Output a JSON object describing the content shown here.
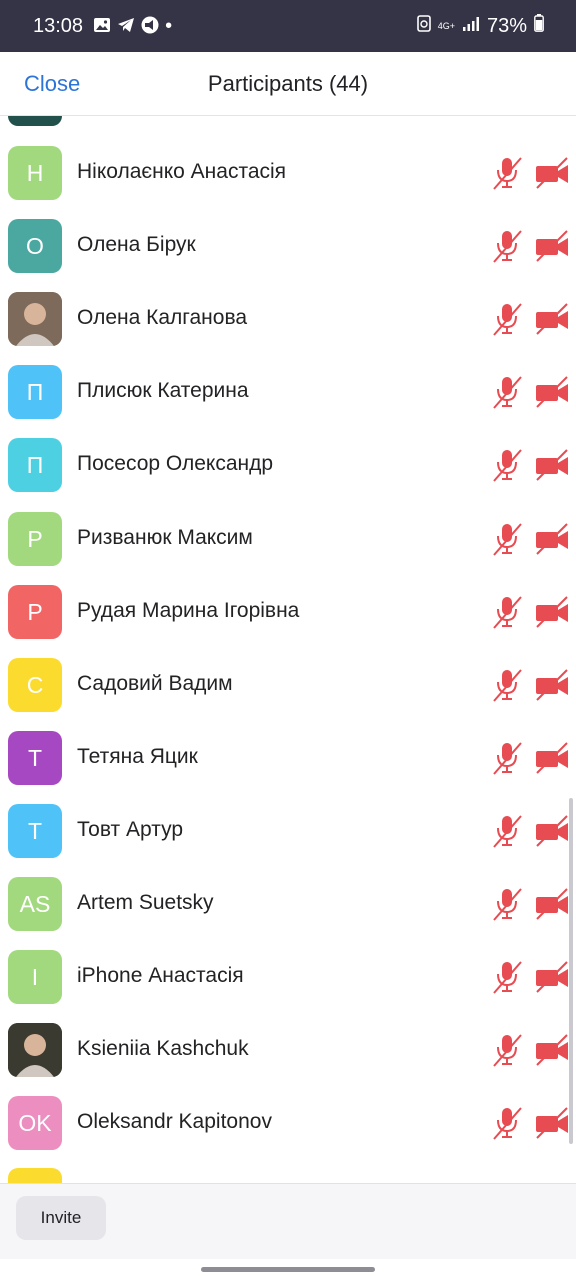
{
  "status_bar": {
    "time": "13:08",
    "icons": [
      "gallery-icon",
      "telegram-icon",
      "megaphone-icon"
    ],
    "dot": "•",
    "network": "4G+",
    "battery": "73%"
  },
  "header": {
    "close_label": "Close",
    "title": "Participants (44)"
  },
  "colors": {
    "accent": "#2d74d9",
    "muted_red": "#e74c52",
    "status_bar_bg": "#353346"
  },
  "participants": [
    {
      "initial": "Н",
      "name": "Ніколаєнко Анастасія",
      "color": "#a2d97e",
      "photo": false
    },
    {
      "initial": "О",
      "name": "Олена Бірук",
      "color": "#4aa8a1",
      "photo": false
    },
    {
      "initial": "",
      "name": "Олена Калганова",
      "color": "#7d6a5a",
      "photo": true
    },
    {
      "initial": "П",
      "name": "Плисюк Катерина",
      "color": "#4fc3f7",
      "photo": false
    },
    {
      "initial": "П",
      "name": "Посесор Олександр",
      "color": "#4dd0e1",
      "photo": false
    },
    {
      "initial": "Р",
      "name": "Ризванюк Максим",
      "color": "#a2d97e",
      "photo": false
    },
    {
      "initial": "Р",
      "name": "Рудая Марина Ігорівна",
      "color": "#f26565",
      "photo": false
    },
    {
      "initial": "С",
      "name": "Садовий Вадим",
      "color": "#fbdc2e",
      "photo": false
    },
    {
      "initial": "Т",
      "name": "Тетяна Яцик",
      "color": "#a648c2",
      "photo": false
    },
    {
      "initial": "Т",
      "name": "Товт Артур",
      "color": "#4fc3f7",
      "photo": false
    },
    {
      "initial": "AS",
      "name": "Artem Suetsky",
      "color": "#a2d97e",
      "photo": false
    },
    {
      "initial": "I",
      "name": "iPhone Анастасія",
      "color": "#a2d97e",
      "photo": false
    },
    {
      "initial": "",
      "name": "Ksieniia Kashchuk",
      "color": "#3a3a30",
      "photo": true
    },
    {
      "initial": "OK",
      "name": "Oleksandr Kapitonov",
      "color": "#ec8ec0",
      "photo": false
    }
  ],
  "footer": {
    "invite_label": "Invite"
  }
}
